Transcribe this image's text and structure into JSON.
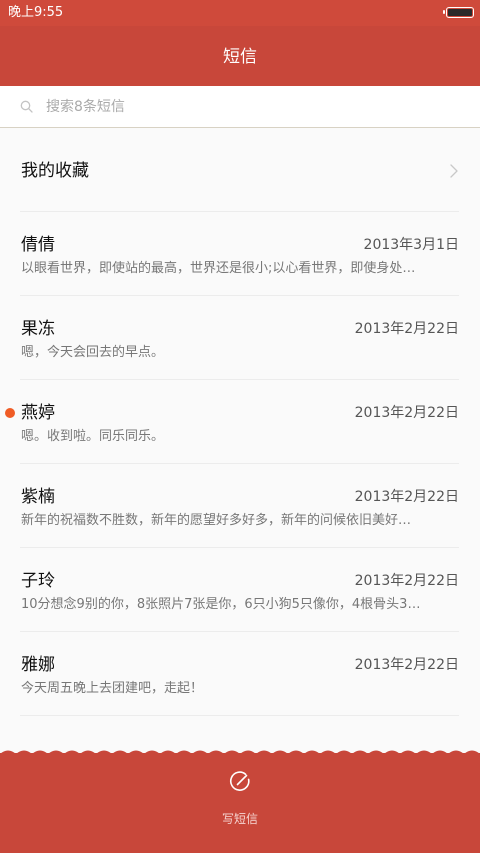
{
  "status_bar": {
    "time": "晚上9:55"
  },
  "header": {
    "title": "短信"
  },
  "search": {
    "placeholder": "搜索8条短信",
    "value": ""
  },
  "favorites": {
    "label": "我的收藏"
  },
  "conversations": [
    {
      "name": "倩倩",
      "date": "2013年3月1日",
      "preview": "以眼看世界，即使站的最高，世界还是很小;以心看世界，即使身处…",
      "unread": false
    },
    {
      "name": "果冻",
      "date": "2013年2月22日",
      "preview": "嗯，今天会回去的早点。",
      "unread": false
    },
    {
      "name": "燕婷",
      "date": "2013年2月22日",
      "preview": "嗯。收到啦。同乐同乐。",
      "unread": true
    },
    {
      "name": "紫楠",
      "date": "2013年2月22日",
      "preview": "新年的祝福数不胜数，新年的愿望好多好多，新年的问候依旧美好…",
      "unread": false
    },
    {
      "name": "子玲",
      "date": "2013年2月22日",
      "preview": "10分想念9别的你，8张照片7张是你，6只小狗5只像你，4根骨头3…",
      "unread": false
    },
    {
      "name": "雅娜",
      "date": "2013年2月22日",
      "preview": "今天周五晚上去团建吧，走起！",
      "unread": false
    }
  ],
  "bottom_bar": {
    "compose_label": "写短信"
  },
  "colors": {
    "header": "#c8473a",
    "status_bar": "#cf4a3b",
    "unread_dot": "#f05c25",
    "background": "#fafafa"
  },
  "icons": {
    "search": "search-icon",
    "chevron": "chevron-right-icon",
    "compose": "compose-icon",
    "battery": "battery-icon"
  }
}
